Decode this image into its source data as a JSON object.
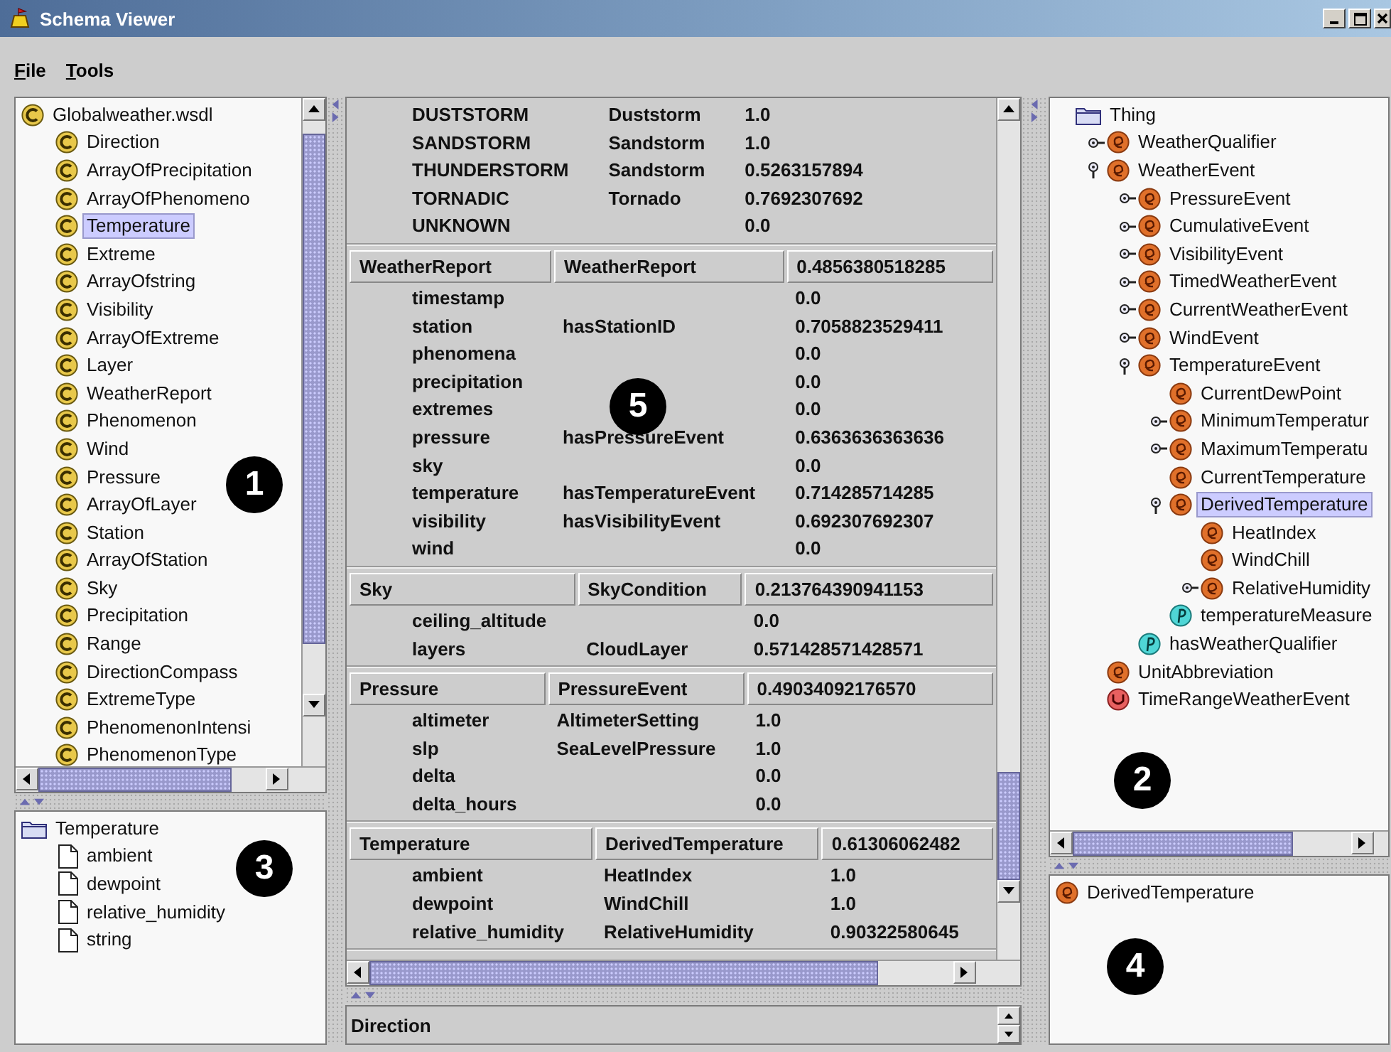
{
  "window": {
    "title": "Schema Viewer"
  },
  "menu": [
    {
      "label": "File"
    },
    {
      "label": "Tools"
    }
  ],
  "class_tree": {
    "callout": "1",
    "root": {
      "label": "Globalweather.wsdl",
      "kind": "class",
      "selected": false,
      "children": [
        {
          "label": "Direction",
          "kind": "class",
          "selected": false
        },
        {
          "label": "ArrayOfPrecipitation",
          "kind": "class",
          "selected": false
        },
        {
          "label": "ArrayOfPhenomeno",
          "kind": "class",
          "selected": false
        },
        {
          "label": "Temperature",
          "kind": "class",
          "selected": true
        },
        {
          "label": "Extreme",
          "kind": "class",
          "selected": false
        },
        {
          "label": "ArrayOfstring",
          "kind": "class",
          "selected": false
        },
        {
          "label": "Visibility",
          "kind": "class",
          "selected": false
        },
        {
          "label": "ArrayOfExtreme",
          "kind": "class",
          "selected": false
        },
        {
          "label": "Layer",
          "kind": "class",
          "selected": false
        },
        {
          "label": "WeatherReport",
          "kind": "class",
          "selected": false
        },
        {
          "label": "Phenomenon",
          "kind": "class",
          "selected": false
        },
        {
          "label": "Wind",
          "kind": "class",
          "selected": false
        },
        {
          "label": "Pressure",
          "kind": "class",
          "selected": false
        },
        {
          "label": "ArrayOfLayer",
          "kind": "class",
          "selected": false
        },
        {
          "label": "Station",
          "kind": "class",
          "selected": false
        },
        {
          "label": "ArrayOfStation",
          "kind": "class",
          "selected": false
        },
        {
          "label": "Sky",
          "kind": "class",
          "selected": false
        },
        {
          "label": "Precipitation",
          "kind": "class",
          "selected": false
        },
        {
          "label": "Range",
          "kind": "class",
          "selected": false
        },
        {
          "label": "DirectionCompass",
          "kind": "class",
          "selected": false
        },
        {
          "label": "ExtremeType",
          "kind": "class",
          "selected": false
        },
        {
          "label": "PhenomenonIntensi",
          "kind": "class",
          "selected": false
        },
        {
          "label": "PhenomenonType",
          "kind": "class",
          "selected": false
        }
      ]
    }
  },
  "member_list": {
    "callout": "3",
    "root": {
      "label": "Temperature",
      "kind": "folder",
      "children": [
        {
          "label": "ambient",
          "kind": "file"
        },
        {
          "label": "dewpoint",
          "kind": "file"
        },
        {
          "label": "relative_humidity",
          "kind": "file"
        },
        {
          "label": "string",
          "kind": "file"
        }
      ]
    }
  },
  "match_table": {
    "callout": "5",
    "groups": [
      {
        "rows": [
          {
            "name": "DUSTSTORM",
            "match": "Duststorm",
            "score": "1.0"
          },
          {
            "name": "SANDSTORM",
            "match": "Sandstorm",
            "score": "1.0"
          },
          {
            "name": "THUNDERSTORM",
            "match": "Sandstorm",
            "score": "0.5263157894"
          },
          {
            "name": "TORNADIC",
            "match": "Tornado",
            "score": "0.7692307692"
          },
          {
            "name": "UNKNOWN",
            "score": "0.0"
          }
        ]
      },
      {
        "header": [
          "WeatherReport",
          "WeatherReport",
          "0.4856380518285"
        ],
        "rows": [
          {
            "name": "timestamp",
            "score": "0.0"
          },
          {
            "name": "station",
            "match": "hasStationID",
            "score": "0.7058823529411"
          },
          {
            "name": "phenomena",
            "score": "0.0"
          },
          {
            "name": "precipitation",
            "score": "0.0"
          },
          {
            "name": "extremes",
            "score": "0.0"
          },
          {
            "name": "pressure",
            "match": "hasPressureEvent",
            "score": "0.6363636363636"
          },
          {
            "name": "sky",
            "score": "0.0"
          },
          {
            "name": "temperature",
            "match": "hasTemperatureEvent",
            "score": "0.714285714285"
          },
          {
            "name": "visibility",
            "match": "hasVisibilityEvent",
            "score": "0.692307692307"
          },
          {
            "name": "wind",
            "score": "0.0"
          }
        ]
      },
      {
        "header": [
          "Sky",
          "SkyCondition",
          "0.213764390941153"
        ],
        "rows": [
          {
            "name": "ceiling_altitude",
            "score": "0.0"
          },
          {
            "name": "layers",
            "match": "CloudLayer",
            "score": "0.571428571428571"
          }
        ]
      },
      {
        "header": [
          "Pressure",
          "PressureEvent",
          "0.49034092176570"
        ],
        "rows": [
          {
            "name": "altimeter",
            "match": "AltimeterSetting",
            "score": "1.0"
          },
          {
            "name": "slp",
            "match": "SeaLevelPressure",
            "score": "1.0"
          },
          {
            "name": "delta",
            "score": "0.0"
          },
          {
            "name": "delta_hours",
            "score": "0.0"
          }
        ]
      },
      {
        "header": [
          "Temperature",
          "DerivedTemperature",
          "0.61306062482"
        ],
        "rows": [
          {
            "name": "ambient",
            "match": "HeatIndex",
            "score": "1.0"
          },
          {
            "name": "dewpoint",
            "match": "WindChill",
            "score": "1.0"
          },
          {
            "name": "relative_humidity",
            "match": "RelativeHumidity",
            "score": "0.90322580645"
          }
        ]
      }
    ]
  },
  "class_selector": {
    "value": "Direction"
  },
  "concept_tree": {
    "callout": "2",
    "root": {
      "label": "Thing",
      "kind": "folder",
      "selected": false,
      "children": [
        {
          "label": "WeatherQualifier",
          "kind": "concept",
          "selected": false,
          "expanded": false
        },
        {
          "label": "WeatherEvent",
          "kind": "concept",
          "selected": false,
          "expanded": true,
          "children": [
            {
              "label": "PressureEvent",
              "kind": "concept",
              "selected": false,
              "expanded": false
            },
            {
              "label": "CumulativeEvent",
              "kind": "concept",
              "selected": false,
              "expanded": false
            },
            {
              "label": "VisibilityEvent",
              "kind": "concept",
              "selected": false,
              "expanded": false
            },
            {
              "label": "TimedWeatherEvent",
              "kind": "concept",
              "selected": false,
              "expanded": false
            },
            {
              "label": "CurrentWeatherEvent",
              "kind": "concept",
              "selected": false,
              "expanded": false
            },
            {
              "label": "WindEvent",
              "kind": "concept",
              "selected": false,
              "expanded": false
            },
            {
              "label": "TemperatureEvent",
              "kind": "concept",
              "selected": false,
              "expanded": true,
              "children": [
                {
                  "label": "CurrentDewPoint",
                  "kind": "concept",
                  "selected": false
                },
                {
                  "label": "MinimumTemperatur",
                  "kind": "concept",
                  "selected": false,
                  "expanded": false
                },
                {
                  "label": "MaximumTemperatu",
                  "kind": "concept",
                  "selected": false,
                  "expanded": false
                },
                {
                  "label": "CurrentTemperature",
                  "kind": "concept",
                  "selected": false
                },
                {
                  "label": "DerivedTemperature",
                  "kind": "concept",
                  "selected": true,
                  "expanded": true,
                  "children": [
                    {
                      "label": "HeatIndex",
                      "kind": "concept",
                      "selected": false
                    },
                    {
                      "label": "WindChill",
                      "kind": "concept",
                      "selected": false
                    },
                    {
                      "label": "RelativeHumidity",
                      "kind": "concept",
                      "selected": false,
                      "expanded": false
                    }
                  ]
                },
                {
                  "label": "temperatureMeasure",
                  "kind": "property",
                  "selected": false
                }
              ]
            },
            {
              "label": "hasWeatherQualifier",
              "kind": "property",
              "selected": false
            }
          ]
        },
        {
          "label": "UnitAbbreviation",
          "kind": "concept",
          "selected": false
        },
        {
          "label": "TimeRangeWeatherEvent",
          "kind": "union",
          "selected": false
        }
      ]
    }
  },
  "selected_concept": {
    "callout": "4",
    "items": [
      {
        "label": "DerivedTemperature",
        "kind": "concept"
      }
    ]
  }
}
